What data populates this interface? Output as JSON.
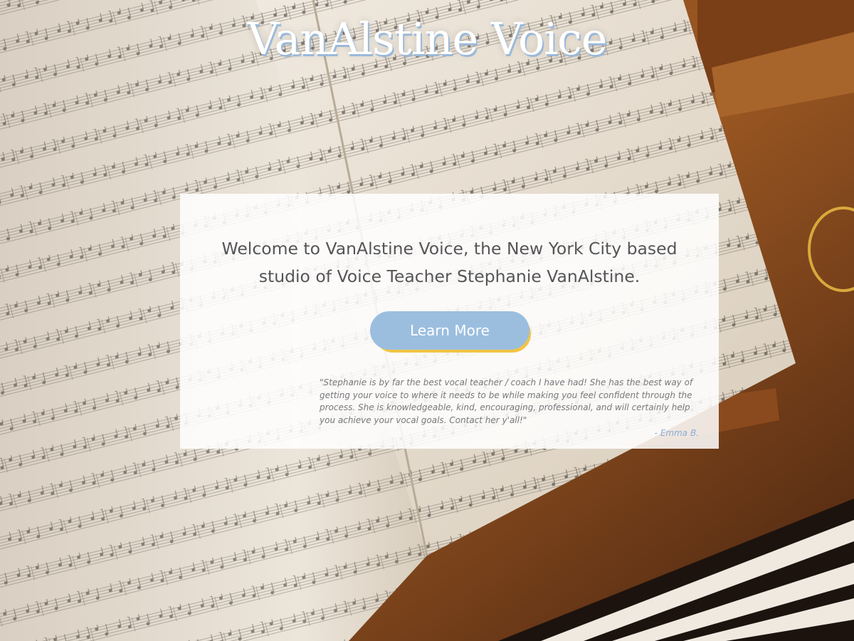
{
  "site": {
    "title": "VanAlstine Voice"
  },
  "hero": {
    "welcome_text": "Welcome to VanAlstine Voice, the New York City based studio of Voice Teacher Stephanie VanAlstine.",
    "button_label": "Learn More",
    "testimonial_text": "\"Stephanie is by far the best vocal teacher / coach I have had! She has the best way of getting your voice to where it needs to be while making you feel confident through the process. She is knowledgeable, kind, encouraging, professional, and will certainly help you achieve your vocal goals. Contact her y'all!\"",
    "testimonial_author": "- Emma B."
  },
  "colors": {
    "button": "#9bbedf",
    "button_shadow": "#f1c443",
    "title_shadow": "#9ab9d9",
    "body_text": "#555558",
    "author_text": "#8aaed4"
  }
}
